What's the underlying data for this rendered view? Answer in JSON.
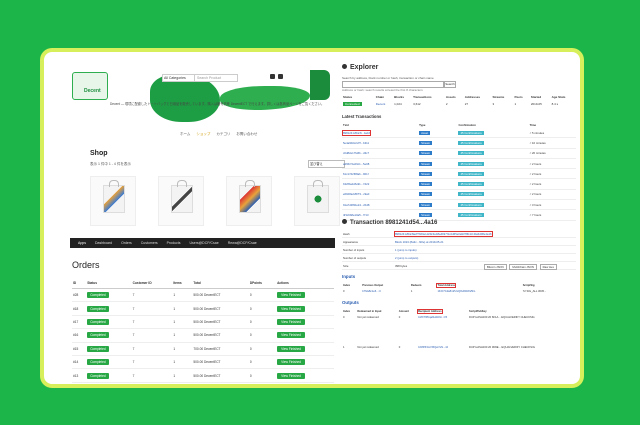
{
  "shop": {
    "logo_text": "Decent",
    "category_select": "All Categories",
    "search_placeholder": "Search Product",
    "intro_text": "Decent — 環境に配慮したトートバッグと日用品を販売しています。購入は暗号資産 DecentECT で行えます。詳しくは各商品ページをご覧ください。",
    "breadcrumbs": [
      "ホーム",
      "ショップ",
      "カテゴリ",
      "お問い合わせ"
    ],
    "title": "Shop",
    "subtitle": "表示 1 件中 1 - 4 件を表示",
    "sort_label": "並び替え",
    "products": [
      "product-1",
      "product-2",
      "product-3",
      "product-4"
    ]
  },
  "admin_tabs": [
    "Apps",
    "Dashboard",
    "Orders",
    "Customers",
    "Products",
    "Users@DCP/Csae",
    "Rewa@DCP/Csae"
  ],
  "orders": {
    "title": "Orders",
    "headers": [
      "ID",
      "Status",
      "Customer ID",
      "Items",
      "Total",
      "DPoints",
      "Actions"
    ],
    "rows": [
      {
        "id": "#28",
        "status": "Completed",
        "customer": "7",
        "items": "1",
        "total": "500.00 DecentECT",
        "points": "0",
        "action": "View Finished"
      },
      {
        "id": "#18",
        "status": "Completed",
        "customer": "7",
        "items": "1",
        "total": "500.00 DecentECT",
        "points": "0",
        "action": "View Finished"
      },
      {
        "id": "#17",
        "status": "Completed",
        "customer": "7",
        "items": "1",
        "total": "500.00 DecentECT",
        "points": "0",
        "action": "View Finished"
      },
      {
        "id": "#16",
        "status": "Completed",
        "customer": "7",
        "items": "1",
        "total": "500.00 DecentECT",
        "points": "0",
        "action": "View Finished"
      },
      {
        "id": "#15",
        "status": "Completed",
        "customer": "7",
        "items": "1",
        "total": "700.00 DecentECT",
        "points": "0",
        "action": "View Finished"
      },
      {
        "id": "#14",
        "status": "Completed",
        "customer": "7",
        "items": "1",
        "total": "500.00 DecentECT",
        "points": "0",
        "action": "View Finished"
      },
      {
        "id": "#13",
        "status": "Completed",
        "customer": "7",
        "items": "1",
        "total": "500.00 DecentECT",
        "points": "0",
        "action": "View Finished"
      }
    ]
  },
  "explorer": {
    "title": "Explorer",
    "desc": "Search by address, block number or hash, transaction or chain name",
    "search_button": "Search",
    "hint": "Address or hash: search results at least the first 8 characters",
    "stats_headers": [
      "Status",
      "Chain",
      "Blocks",
      "Transactions",
      "Assets",
      "Addresses",
      "Streams",
      "Peers",
      "Started",
      "Age Stats"
    ],
    "stats_row": [
      "Connected",
      "Decent",
      "1,024",
      "3,612",
      "2",
      "27",
      "3",
      "1",
      "2019-05",
      "8.4 s"
    ],
    "latest_title": "Latest Transactions",
    "tx_headers": [
      "Txid",
      "Type",
      "Confirmation",
      "Time"
    ],
    "tx_rows": [
      {
        "txid": "8981241d54c8...4a16",
        "type": "Asset",
        "conf": "45 Confirmations",
        "time": "< 5 minutes"
      },
      {
        "txid": "5e4a9b0c2d7f...b311",
        "type": "Stream",
        "conf": "45 Confirmations",
        "time": "< 10 minutes"
      },
      {
        "txid": "c0d82e1f7a5b...d3c7",
        "type": "Stream",
        "conf": "45 Confirmations",
        "time": "< 20 minutes"
      },
      {
        "txid": "a4f3b72e09c1...5e08",
        "type": "Stream",
        "conf": "45 Confirmations",
        "time": "< 2 hours"
      },
      {
        "txid": "61c17d2f08ab...901f",
        "type": "Stream",
        "conf": "45 Confirmations",
        "time": "< 2 hours"
      },
      {
        "txid": "b32f6a4c8e91...7d22",
        "type": "Stream",
        "conf": "45 Confirmations",
        "time": "< 2 hours"
      },
      {
        "txid": "e6b08a2d57f3...c9a0",
        "type": "Stream",
        "conf": "45 Confirmations",
        "time": "< 2 hours"
      },
      {
        "txid": "91a7d3f60e24...2b48",
        "type": "Stream",
        "conf": "45 Confirmations",
        "time": "< 3 hours"
      },
      {
        "txid": "4f3c6b8e10a5...f713",
        "type": "Stream",
        "conf": "45 Confirmations",
        "time": "< 7 hours"
      }
    ],
    "tx_title": "Transaction 8981241d54...4a16",
    "kv": [
      [
        "Hash",
        "8981241d54c8a2f7b60e1d29c3e48a4b97f1c2d65e0a9378b4c1f2a6d08e4a16"
      ],
      [
        "Appearance",
        "Block 1024 (8a3c...f20e) at 2019-05-21"
      ],
      [
        "Number of inputs",
        "1 (jump to inputs)"
      ],
      [
        "Number of outputs",
        "2 (jump to outputs)"
      ],
      [
        "Size",
        "398 bytes"
      ]
    ],
    "buttons": [
      "Bitcoin JSON",
      "MultiChain JSON",
      "Raw Hex"
    ],
    "inputs_title": "Inputs",
    "inputs_headers": [
      "Index",
      "Previous Output",
      "Redeem",
      "Total Address",
      "ScriptSig"
    ],
    "inputs_row": [
      "0",
      "b7f2a8c1e6...:0",
      "1",
      "1KrF7Cde8mP2xQ9vR3tWs5hL",
      "72 SIG_ALL 3045..."
    ],
    "outputs_title": "Outputs",
    "outputs_headers": [
      "Index",
      "Redeemed in Input",
      "Amount",
      "Recipient Address",
      "ScriptPubKey"
    ],
    "outputs_rows": [
      [
        "0",
        "Not yet redeemed",
        "0",
        "1MX7fPbqa9LkR2d...C5",
        "DUP HASH160 20 6F1A... EQUALVERIFY CHECKSIG"
      ],
      [
        "1",
        "Not yet redeemed",
        "0",
        "1K8PZ3mVt5Qw7eN...4J",
        "DUP HASH160 20 3D9E... EQUALVERIFY CHECKSIG"
      ]
    ]
  }
}
